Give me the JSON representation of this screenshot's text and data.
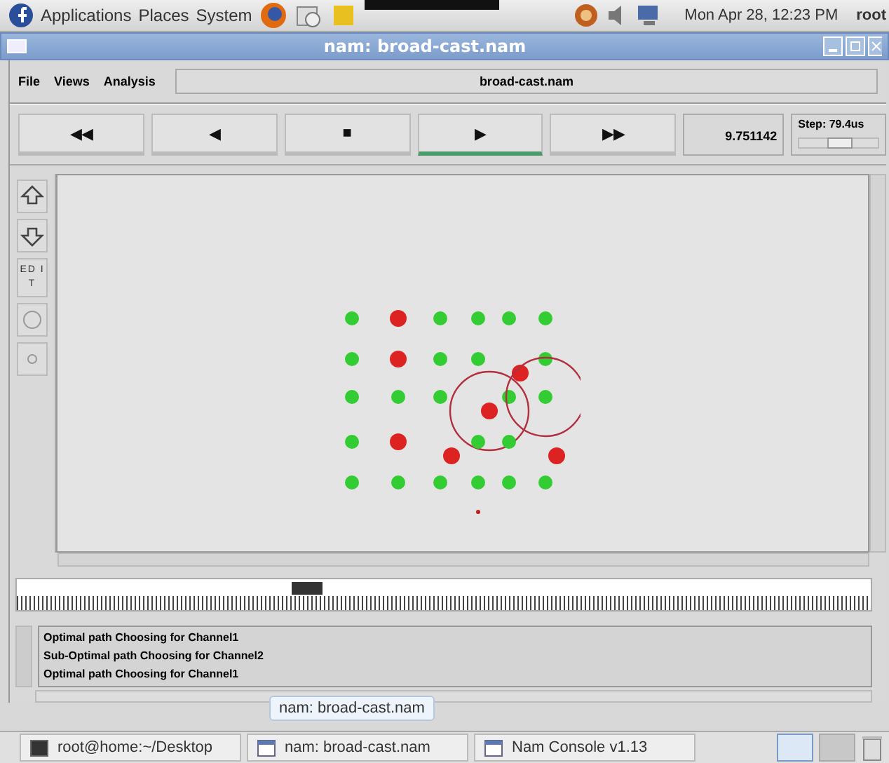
{
  "top_panel": {
    "menus": [
      "Applications",
      "Places",
      "System"
    ],
    "clock": "Mon Apr 28, 12:23 PM",
    "user": "root"
  },
  "window": {
    "title": "nam: broad-cast.nam"
  },
  "menu_bar": {
    "items": [
      "File",
      "Views",
      "Analysis"
    ],
    "file_name": "broad-cast.nam"
  },
  "controls": [
    {
      "label": "◀◀",
      "selected": false
    },
    {
      "label": "◀",
      "selected": false
    },
    {
      "label": "■",
      "selected": false
    },
    {
      "label": "▶",
      "selected": true
    },
    {
      "label": "▶▶",
      "selected": false
    }
  ],
  "time": "9.751142",
  "step": {
    "label": "Step: 79.4us",
    "level": 0.5
  },
  "tools": [
    {
      "kind": "zoom-in"
    },
    {
      "kind": "zoom-out"
    },
    {
      "kind": "edit",
      "label": "ED IT"
    },
    {
      "kind": "circle"
    },
    {
      "kind": "dot"
    }
  ],
  "nodes": [
    {
      "color": "#33cc33"
    },
    {
      "color": "#dd2222"
    },
    {
      "color": "#33cc33"
    },
    {
      "color": "#33cc33"
    },
    {
      "color": "#33cc33"
    },
    {
      "color": "#33cc33"
    },
    {
      "color": "#33cc33"
    },
    {
      "color": "#dd2222"
    },
    {
      "color": "#33cc33"
    },
    {
      "color": "#33cc33"
    },
    {
      "color": "#dd2222"
    },
    {
      "color": "#33cc33"
    },
    {
      "color": "#33cc33"
    },
    {
      "color": "#33cc33"
    },
    {
      "color": "#33cc33"
    },
    {
      "color": "#dd2222",
      "range": true
    },
    {
      "color": "#33cc33"
    },
    {
      "color": "#33cc33",
      "range": true
    },
    {
      "color": "#33cc33"
    },
    {
      "color": "#dd2222"
    },
    {
      "color": "#dd2222"
    },
    {
      "color": "#33cc33"
    },
    {
      "color": "#33cc33"
    },
    {
      "color": "#dd2222"
    },
    {
      "color": "#33cc33"
    },
    {
      "color": "#33cc33"
    },
    {
      "color": "#33cc33"
    },
    {
      "color": "#33cc33"
    },
    {
      "color": "#33cc33"
    },
    {
      "color": "#33cc33"
    }
  ],
  "timeline": {
    "level": 0.34
  },
  "log": [
    "Optimal path Choosing for Channel1",
    "Sub-Optimal path Choosing for Channel2",
    "Optimal path Choosing for Channel1"
  ],
  "tooltip": "nam: broad-cast.nam",
  "taskbar": [
    {
      "kind": "terminal",
      "label": "root@home:~/Desktop"
    },
    {
      "kind": "window",
      "label": "nam: broad-cast.nam"
    },
    {
      "kind": "window",
      "label": "Nam Console v1.13"
    }
  ]
}
